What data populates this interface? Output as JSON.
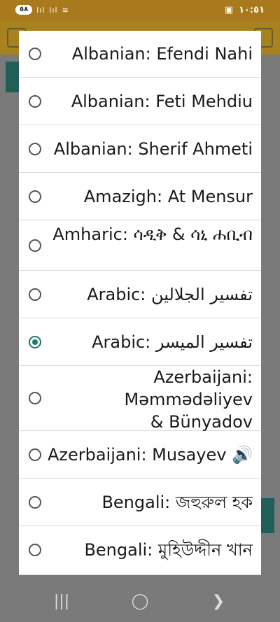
{
  "status_bar": {
    "battery": "٥٨",
    "signal_1": "lıl",
    "signal_2": "lıl",
    "time": "١٠:٥١"
  },
  "dialog": {
    "options": [
      {
        "label": "Albanian: Efendi Nahi",
        "selected": false
      },
      {
        "label": "Albanian: Feti Mehdiu",
        "selected": false
      },
      {
        "label": "Albanian: Sherif Ahmeti",
        "selected": false
      },
      {
        "label": "Amazigh: At Mensur",
        "selected": false
      },
      {
        "label": "Amharic: ሳዲቅ & ሳኒ ሐቢብ",
        "selected": false
      },
      {
        "label": "Arabic: تفسير الجلالين",
        "selected": false
      },
      {
        "label": "Arabic: تفسير الميسر",
        "selected": true
      },
      {
        "label": "Azerbaijani: Məmmədəliyev & Bünyadov",
        "selected": false
      },
      {
        "label": "Azerbaijani: Musayev 🔊",
        "selected": false
      },
      {
        "label": "Bengali: জহুরুল হক",
        "selected": false
      },
      {
        "label": "Bengali: মুহিউদ্দীন খান",
        "selected": false
      }
    ]
  },
  "nav_bar": {
    "recent": "|||",
    "home": "◯",
    "back": "❯"
  }
}
